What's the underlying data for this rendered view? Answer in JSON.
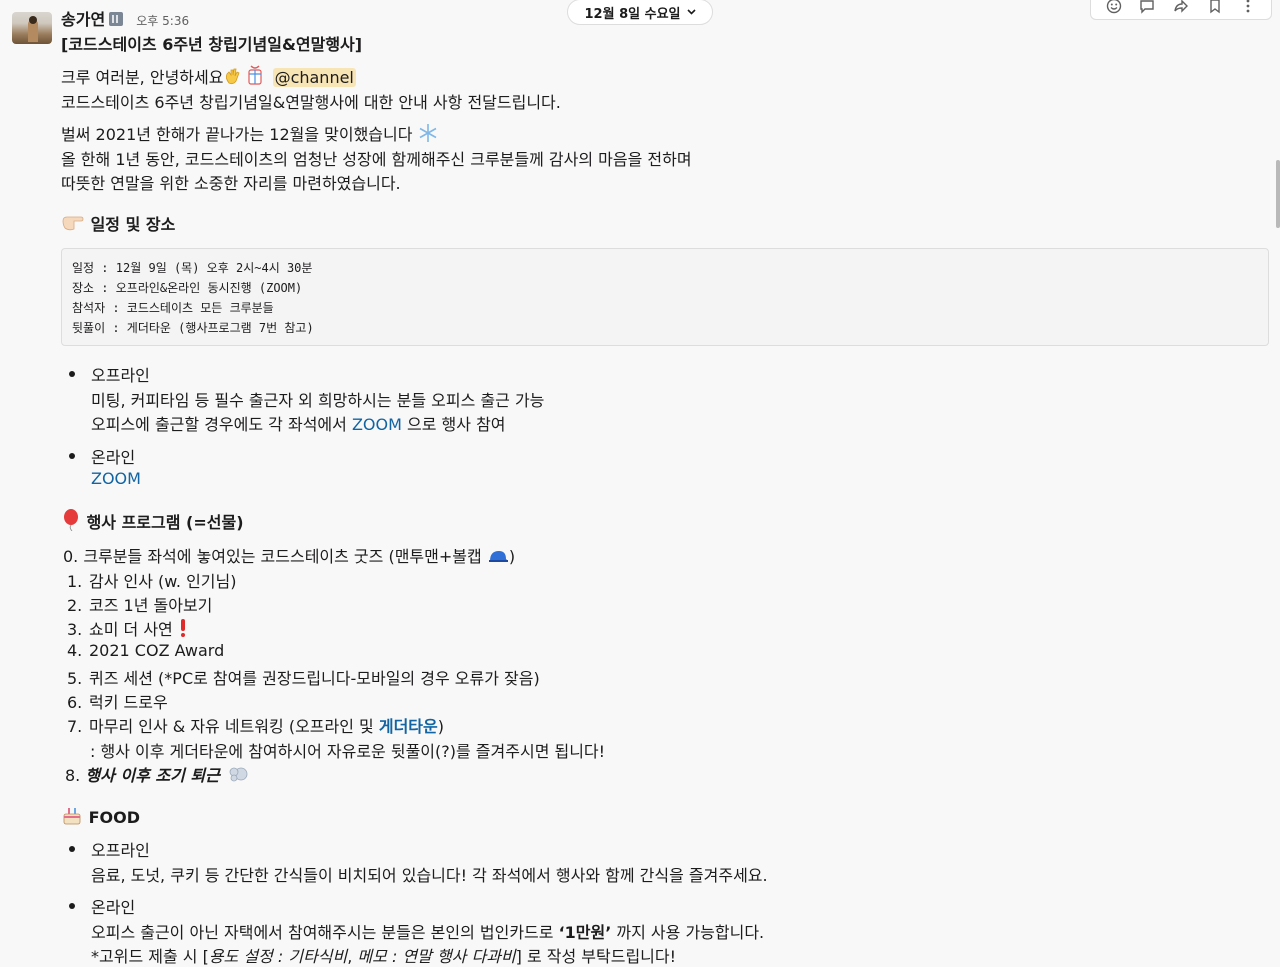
{
  "message": {
    "sender": "송가연",
    "time": "오후 5:36",
    "title": "[코드스테이츠 6주년 창립기념일&연말행사]",
    "greeting": "크루 여러분, 안녕하세요",
    "mention": "@channel",
    "intro": "코드스테이츠 6주년 창립기념일&연말행사에 대한 안내 사항 전달드립니다.",
    "para_lines": [
      "벌써 2021년 한해가 끝나가는 12월을 맞이했습니다",
      "올 한해 1년 동안, 코드스테이츠의 엄청난 성장에 함께해주신 크루분들께 감사의 마음을 전하며",
      "따뜻한 연말을 위한 소중한 자리를 마련하였습니다."
    ]
  },
  "date_divider": {
    "label": "12월 8일 수요일"
  },
  "toolbar": {
    "icons": [
      "emoji-reaction-icon",
      "reply-thread-icon",
      "share-icon",
      "bookmark-icon",
      "more-actions-icon"
    ]
  },
  "schedule": {
    "heading": "일정 및 장소",
    "code_lines": [
      "일정 : 12월 9일 (목) 오후 2시~4시 30분",
      "장소 : 오프라인&온라인 동시진행 (ZOOM)",
      "참석자 : 코드스테이츠 모든 크루분들",
      "뒷풀이 : 게더타운 (행사프로그램 7번 참고)"
    ],
    "offline": {
      "label": "오프라인",
      "line1": "미팅, 커피타임 등 필수 출근자 외 희망하시는 분들 오피스 출근 가능",
      "line2_prefix": "오피스에 출근할 경우에도 각 좌석에서",
      "line2_link": "ZOOM",
      "line2_suffix": "으로 행사 참여"
    },
    "online": {
      "label": "온라인",
      "link": "ZOOM"
    }
  },
  "program": {
    "heading": "행사 프로그램 (=선물)",
    "item0": "0. 크루분들 좌석에 놓여있는 코드스테이츠 굿즈 (맨투맨+볼캡",
    "item0_end": ")",
    "items": [
      {
        "num": "1.",
        "text": "감사 인사 (w. 인기님)"
      },
      {
        "num": "2.",
        "text": "코즈 1년 돌아보기"
      },
      {
        "num": "3.",
        "text": "쇼미 더 사연"
      },
      {
        "num": "4.",
        "text": "2021 COZ Award"
      },
      {
        "num": "5.",
        "text": "퀴즈 세션 (*PC로 참여를 권장드립니다-모바일의 경우 오류가 잦음)"
      },
      {
        "num": "6.",
        "text": "럭키 드로우"
      },
      {
        "num": "7.",
        "text": "마무리 인사 & 자유 네트워킹 (오프라인 및"
      }
    ],
    "item7_link": "게더타운",
    "item7_end": ")",
    "item7_sub": ": 행사 이후 게더타운에 참여하시어 자유로운 뒷풀이(?)를 즐겨주시면 됩니다!",
    "item8_num": "8.",
    "item8_text": "행사 이후 조기 퇴근"
  },
  "food": {
    "heading": "FOOD",
    "offline_label": "오프라인",
    "offline_text": "음료, 도넛, 쿠키 등 간단한 간식들이 비치되어 있습니다! 각 좌석에서 행사와 함께 간식을 즐겨주세요.",
    "online_label": "온라인",
    "online_prefix": "오피스 출근이 아닌 자택에서 참여해주시는 분들은 본인의 법인카드로",
    "online_amount": "‘1만원’",
    "online_suffix": "까지 사용 가능합니다.",
    "guide_prefix": "*고위드 제출 시 [",
    "guide_italic1": "용도 설정 : 기타식비",
    "guide_sep": ", ",
    "guide_italic2": "메모 : 연말 행사 다과비",
    "guide_suffix": "] 로 작성 부탁드립니다!"
  }
}
